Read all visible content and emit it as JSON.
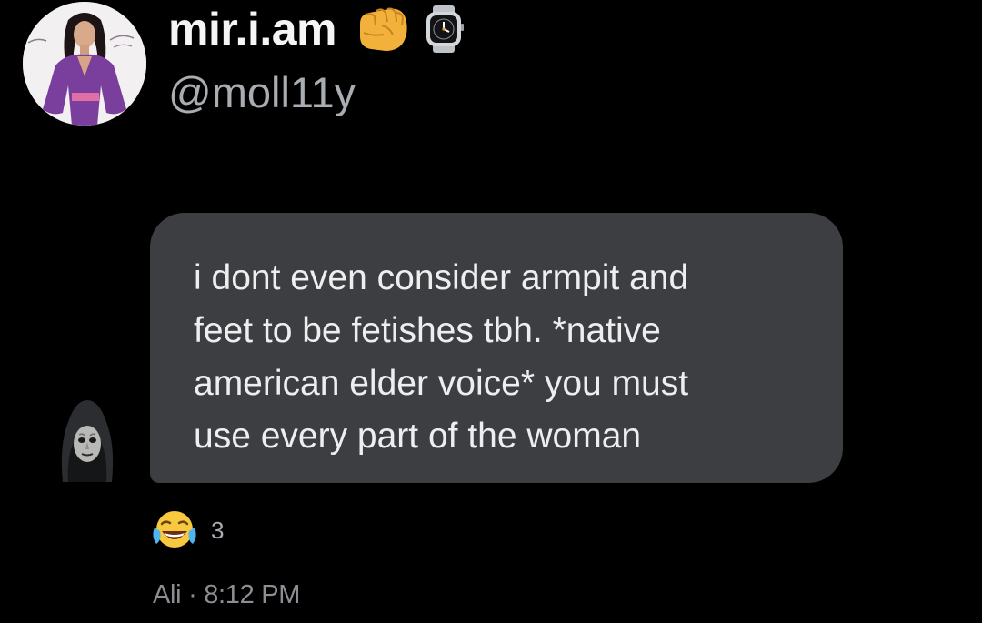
{
  "header": {
    "display_name": "mir.i.am",
    "handle": "@moll11y",
    "name_icons": [
      "oncoming-fist-icon",
      "watch-icon"
    ],
    "avatar_icon": "profile-photo-avatar"
  },
  "message": {
    "lines": [
      "i dont even consider armpit and",
      "feet to be fetishes tbh. *native",
      "american elder voice* you must",
      "use every part of the woman"
    ],
    "sender_avatar_icon": "hooded-mask-avatar"
  },
  "reaction": {
    "emoji": "face-with-tears-of-joy-icon",
    "count": "3"
  },
  "meta": {
    "sender": "Ali",
    "separator": " · ",
    "time": "8:12 PM"
  },
  "colors": {
    "background": "#000000",
    "bubble": "#3c3e41",
    "primary_text": "#eceeef",
    "secondary_text": "#a9acb0"
  }
}
